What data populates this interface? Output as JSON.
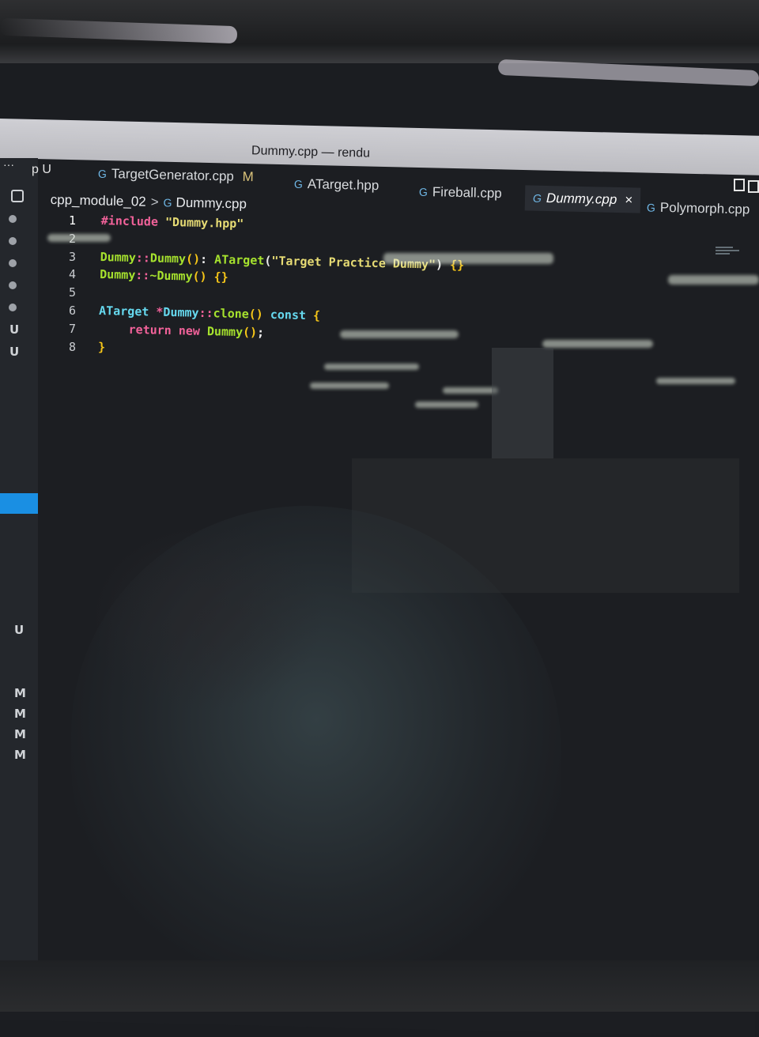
{
  "window": {
    "title": "Dummy.cpp — rendu"
  },
  "toolbar": {
    "overflow": "···",
    "left_label": "p U"
  },
  "tabs": [
    {
      "label": "TargetGenerator.cpp",
      "badge": "M"
    },
    {
      "label": "ATarget.hpp",
      "badge": ""
    },
    {
      "label": "Fireball.cpp",
      "badge": ""
    },
    {
      "label": "Dummy.cpp",
      "badge": "",
      "close": "×"
    },
    {
      "label": "Polymorph.cpp",
      "badge": ""
    }
  ],
  "breadcrumb": {
    "folder": "cpp_module_02",
    "separator": ">",
    "file": "Dummy.cpp"
  },
  "editor": {
    "line_numbers": [
      "1",
      "2",
      "3",
      "4",
      "5",
      "6",
      "7",
      "8"
    ],
    "lines": [
      {
        "include_kw": "#include",
        "include_file": "\"Dummy.hpp\""
      },
      {},
      {
        "cls": "Dummy",
        "sep": "::",
        "fn": "Dummy",
        "paren": "()",
        "colon": ": ",
        "base": "ATarget",
        "open": "(",
        "str": "\"Target Practice Dummy\"",
        "close": ")",
        "braces": " {}"
      },
      {
        "cls": "Dummy",
        "sep": "::",
        "fn": "~Dummy",
        "paren": "()",
        "braces": " {}"
      },
      {},
      {
        "type": "ATarget",
        "star": " *",
        "cls": "Dummy",
        "sep": "::",
        "fn": "clone",
        "paren": "()",
        "kw_const": " const",
        "open_brace": " {"
      },
      {
        "kw_return": "return",
        "kw_new": " new",
        "fn": " Dummy",
        "paren": "()",
        "semi": ";"
      },
      {
        "close_brace": "}"
      }
    ]
  },
  "activity_bar": {
    "status_top": [
      "U",
      "U"
    ],
    "status_bottom": [
      "U",
      "M",
      "M",
      "M",
      "M"
    ]
  }
}
